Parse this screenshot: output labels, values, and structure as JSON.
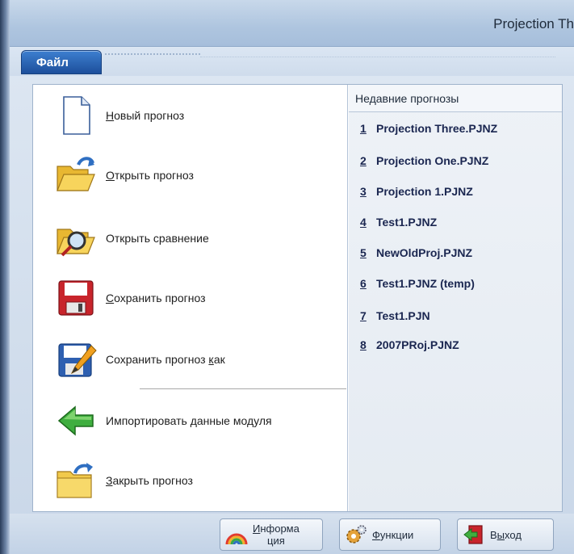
{
  "window": {
    "title": "Projection Th"
  },
  "ribbon": {
    "file_tab": "Файл"
  },
  "commands": [
    {
      "pre": "",
      "acc": "Н",
      "post": "овый прогноз",
      "icon": "new-document-icon"
    },
    {
      "pre": "",
      "acc": "О",
      "post": "ткрыть прогноз",
      "icon": "open-folder-icon"
    },
    {
      "pre": "Открыть сравнение",
      "acc": "",
      "post": "",
      "icon": "open-comparison-icon"
    },
    {
      "pre": "",
      "acc": "С",
      "post": "охранить прогноз",
      "icon": "save-icon"
    },
    {
      "pre": "Сохранить прогноз ",
      "acc": "к",
      "post": "ак",
      "icon": "save-as-icon"
    },
    {
      "pre": "Импортировать данные модуля",
      "acc": "",
      "post": "",
      "icon": "import-arrow-icon"
    },
    {
      "pre": "",
      "acc": "З",
      "post": "акрыть прогноз",
      "icon": "close-folder-icon"
    }
  ],
  "recent": {
    "header": "Недавние прогнозы",
    "items": [
      {
        "num": "1",
        "name": "Projection Three.PJNZ"
      },
      {
        "num": "2",
        "name": "Projection One.PJNZ"
      },
      {
        "num": "3",
        "name": "Projection 1.PJNZ"
      },
      {
        "num": "4",
        "name": "Test1.PJNZ"
      },
      {
        "num": "5",
        "name": "NewOldProj.PJNZ"
      },
      {
        "num": "6",
        "name": "Test1.PJNZ (temp)"
      },
      {
        "num": "7",
        "name": "Test1.PJN"
      },
      {
        "num": "8",
        "name": "2007PRoj.PJNZ"
      }
    ]
  },
  "status": {
    "info": {
      "acc": "И",
      "line1": "нформа",
      "line2": "ция"
    },
    "functions": {
      "acc": "Ф",
      "rest": "ункции"
    },
    "exit": {
      "pre": "В",
      "acc": "ы",
      "post": "ход"
    }
  }
}
